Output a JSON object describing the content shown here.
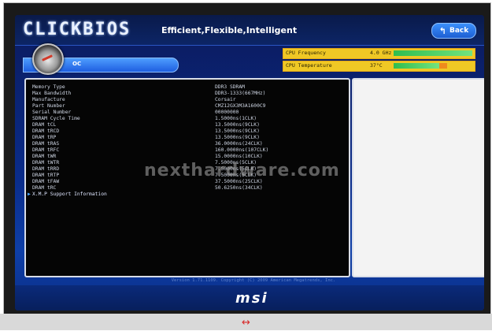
{
  "header": {
    "logo": "CLICKBIOS",
    "tagline": "Efficient,Flexible,Intelligent",
    "back_label": "Back"
  },
  "nav": {
    "oc_label": "OC"
  },
  "status": {
    "cpu_frequency_label": "CPU Frequency",
    "cpu_frequency_value": "4.0 GHz",
    "cpu_temperature_label": "CPU Temperature",
    "cpu_temperature_value": "37°C",
    "bar_color": "#2fbd4f",
    "accent_color": "#efc825"
  },
  "memory_info": [
    {
      "k": "Memory Type",
      "v": "DDR3 SDRAM"
    },
    {
      "k": "Max Bandwidth",
      "v": "DDR3-1333(667MHz)"
    },
    {
      "k": "Manufacture",
      "v": "Corsair"
    },
    {
      "k": "Part Number",
      "v": "CMZ12GX3M3A1600C9"
    },
    {
      "k": "Serial Number",
      "v": "00000000"
    },
    {
      "k": "SDRAM Cycle Time",
      "v": "1.5000ns(1CLK)"
    },
    {
      "k": "DRAM tCL",
      "v": "13.5000ns(9CLK)"
    },
    {
      "k": "DRAM tRCD",
      "v": "13.5000ns(9CLK)"
    },
    {
      "k": "DRAM tRP",
      "v": "13.5000ns(9CLK)"
    },
    {
      "k": "DRAM tRAS",
      "v": "36.0000ns(24CLK)"
    },
    {
      "k": "DRAM tRFC",
      "v": "160.0000ns(107CLK)"
    },
    {
      "k": "DRAM tWR",
      "v": "15.0000ns(10CLK)"
    },
    {
      "k": "DRAM tWTR",
      "v": "7.5000ns(5CLK)"
    },
    {
      "k": "DRAM tRRD",
      "v": "7.5000ns(5CLK)"
    },
    {
      "k": "DRAM tRTP",
      "v": "7.5000ns(5CLK)"
    },
    {
      "k": "DRAM tFAW",
      "v": "37.5000ns(25CLK)"
    },
    {
      "k": "DRAM tRC",
      "v": "50.6250ns(34CLK)"
    }
  ],
  "xmp_label": "X.M.P Support Information",
  "watermark": "nexthardware.com",
  "version_text": "Version 1.71.1109. Copyright (C) 2009 American Megatrends, Inc.",
  "footer": {
    "brand": "msi"
  },
  "caption_icon": "↔"
}
